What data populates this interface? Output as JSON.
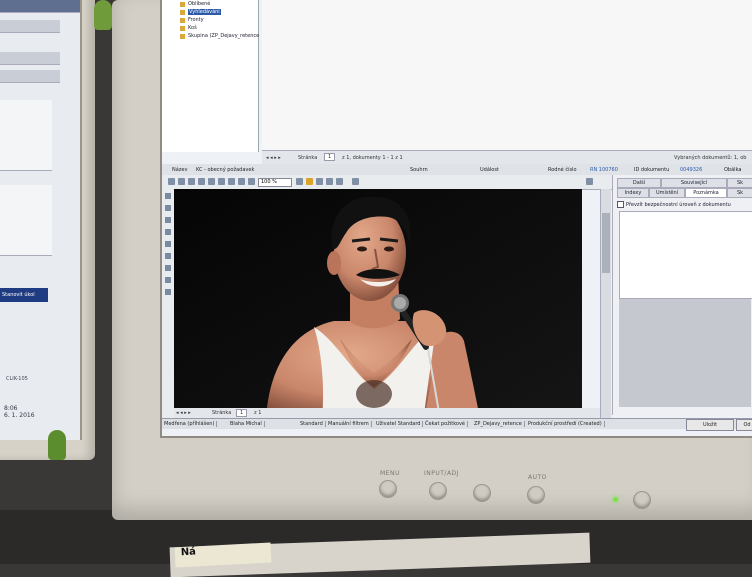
{
  "tree": {
    "items": [
      "Oblíbené",
      "Vyhledávání",
      "Fronty",
      "Koš",
      "Skupina (ZP_Dejavy_retence"
    ]
  },
  "pager_top": {
    "label": "Stránka",
    "value": "1",
    "range": "z 1, dokumenty 1 - 1 z 1",
    "selected_info": "Vybraných dokumentů: 1, ob"
  },
  "column_header": {
    "name": "Název",
    "name_value": "KC - obecný požadavek",
    "summary": "Souhrn",
    "event": "Událost",
    "birth_number": "Rodné číslo",
    "birth_number_value": "RN 100760",
    "doc_id": "ID dokumentu",
    "doc_id_value": "0049326",
    "tab": "Obálka"
  },
  "toolbar": {
    "zoom": "100 %"
  },
  "pager_doc": {
    "label": "Stránka",
    "value": "1",
    "of": "z 1"
  },
  "right_panel": {
    "tabs_row1": [
      "Další",
      "Související",
      "Sk"
    ],
    "tabs_row2": [
      "Indexy",
      "Umístění",
      "Poznámka",
      "Sk"
    ],
    "checkbox_label": "Převzít bezpečnostní úroveň z dokumentu"
  },
  "status_bar": [
    "Medřena (příhlášen)",
    "Blaha Michal",
    "Standard",
    "Manuální filtrem",
    "Uživatel Standard",
    "Čekat požitkové",
    "ZP_Dejavy_retence",
    "Produkční prostředí (Created)"
  ],
  "buttons": {
    "ok": "Uložit",
    "other": "Od"
  },
  "left_monitor": {
    "task": "Stanovit úkol",
    "code": "CLIK-105",
    "time": "8:06",
    "date": "6. 1. 2016"
  },
  "bezel": {
    "labels": [
      "MENU",
      "INPUT/ADJ",
      "AUTO"
    ]
  },
  "note": {
    "text": "Ná"
  },
  "colors": {
    "accent": "#2d5aa8",
    "led": "#7de34a"
  }
}
